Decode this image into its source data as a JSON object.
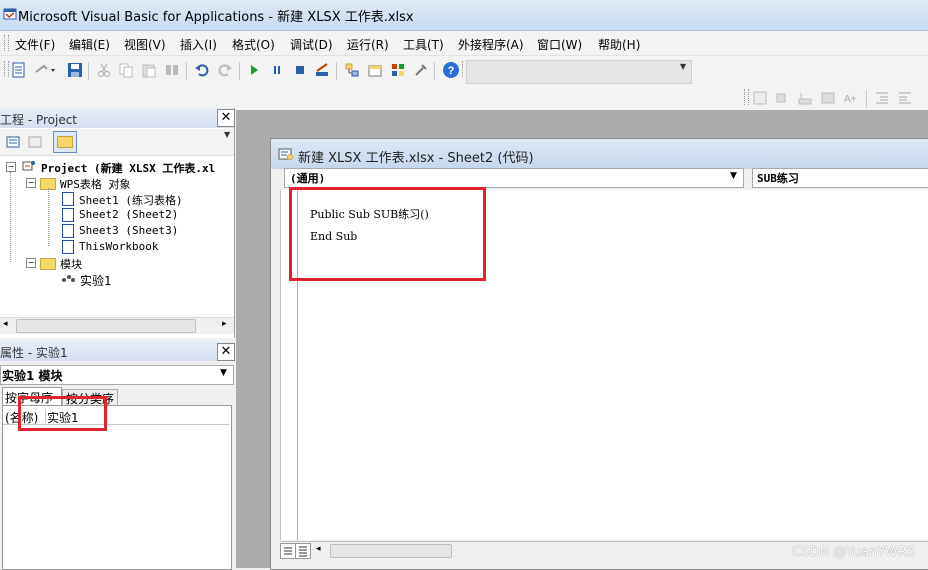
{
  "window": {
    "title": "Microsoft Visual Basic for Applications - 新建 XLSX 工作表.xlsx"
  },
  "menu": [
    "文件(F)",
    "编辑(E)",
    "视图(V)",
    "插入(I)",
    "格式(O)",
    "调试(D)",
    "运行(R)",
    "工具(T)",
    "外接程序(A)",
    "窗口(W)",
    "帮助(H)"
  ],
  "toolbar": {
    "icons": [
      "insert-userform-icon",
      "undo-dropdown-icon",
      "save-icon",
      "cut-icon",
      "copy-icon",
      "paste-icon",
      "find-icon",
      "undo-icon",
      "redo-icon",
      "run-icon",
      "break-icon",
      "reset-icon",
      "design-mode-icon",
      "project-explorer-icon",
      "properties-icon",
      "object-browser-icon",
      "toolbox-icon",
      "help-icon"
    ]
  },
  "project_pane": {
    "title": "工程 - Project",
    "tree": {
      "root": "Project (新建 XLSX 工作表.xl",
      "wps_folder": "WPS表格 对象",
      "sheets": [
        "Sheet1 (练习表格)",
        "Sheet2 (Sheet2)",
        "Sheet3 (Sheet3)",
        "ThisWorkbook"
      ],
      "modules_folder": "模块",
      "module": "实验1"
    }
  },
  "properties_pane": {
    "title": "属性 - 实验1",
    "object_combo": "实验1 模块",
    "tabs": [
      "按字母序",
      "按分类序"
    ],
    "row_name": "(名称)",
    "row_value": "实验1"
  },
  "code_window": {
    "title": "新建 XLSX 工作表.xlsx - Sheet2 (代码)",
    "object_combo": "(通用)",
    "proc_combo": "SUB练习",
    "lines": [
      "Public Sub SUB练习()",
      "End Sub"
    ]
  },
  "watermark": "CSDN @YuanYWRS",
  "colors": {
    "highlight_red": "#e0232e",
    "title_gradient": "#c9dbef",
    "mdi_background": "#ababab"
  }
}
